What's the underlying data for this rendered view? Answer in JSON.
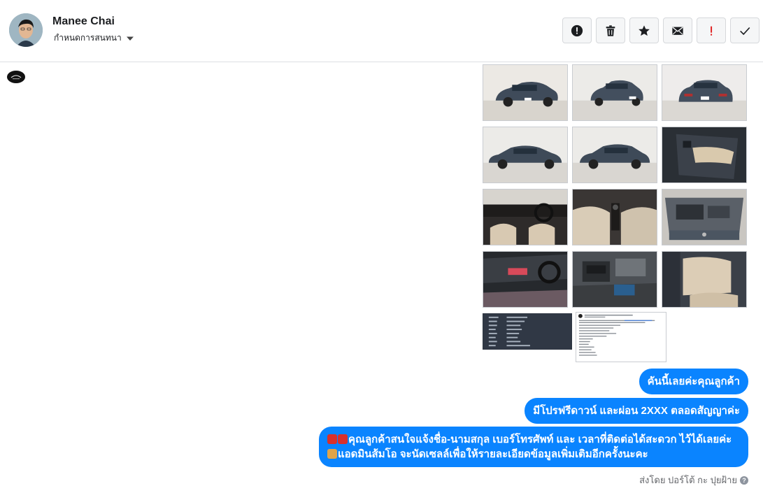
{
  "header": {
    "name": "Manee Chai",
    "assign_label": "กำหนดการสนทนา",
    "actions": [
      {
        "icon": "alert-circle-icon",
        "name": "mark-spam-button"
      },
      {
        "icon": "trash-icon",
        "name": "delete-button"
      },
      {
        "icon": "star-icon",
        "name": "star-button"
      },
      {
        "icon": "envelope-icon",
        "name": "mark-unread-button"
      },
      {
        "icon": "exclamation-icon",
        "name": "priority-button",
        "color": "#e02020"
      },
      {
        "icon": "check-icon",
        "name": "done-button"
      }
    ]
  },
  "thread": {
    "page_logo": "page-logo",
    "attachments": [
      {
        "type": "photo",
        "subject": "car-front-left"
      },
      {
        "type": "photo",
        "subject": "car-front"
      },
      {
        "type": "photo",
        "subject": "car-rear"
      },
      {
        "type": "photo",
        "subject": "car-side"
      },
      {
        "type": "photo",
        "subject": "car-side-rear"
      },
      {
        "type": "photo",
        "subject": "door-panel"
      },
      {
        "type": "photo",
        "subject": "interior-dashboard"
      },
      {
        "type": "photo",
        "subject": "interior-seats"
      },
      {
        "type": "photo",
        "subject": "engine-bay"
      },
      {
        "type": "photo",
        "subject": "console"
      },
      {
        "type": "photo",
        "subject": "engine-detail"
      },
      {
        "type": "photo",
        "subject": "rear-seats"
      },
      {
        "type": "screenshot",
        "subject": "spec-sheet-dark"
      },
      {
        "type": "screenshot",
        "subject": "post-screenshot"
      }
    ],
    "messages": [
      {
        "text": "คันนี้เลยค่ะคุณลูกค้า"
      },
      {
        "text": "มีโปรฟรีดาวน์ และผ่อน 2XXX ตลอดสัญญาค่ะ"
      },
      {
        "line1": "คุณลูกค้าสนใจแจ้งชื่อ-นามสกุล เบอร์โทรศัพท์ และ เวลาที่ติดต่อได้สะดวก ไว้ได้เลยค่ะ",
        "line2": "แอดมินส้มโอ จะนัดเซลล์เพื่อให้รายละเอียดข้อมูลเพิ่มเติมอีกครั้งนะคะ"
      }
    ],
    "sent_by": "ส่งโดย ปอร์โต้ กะ ปุยฝ้าย",
    "accent": "#0a84ff"
  }
}
